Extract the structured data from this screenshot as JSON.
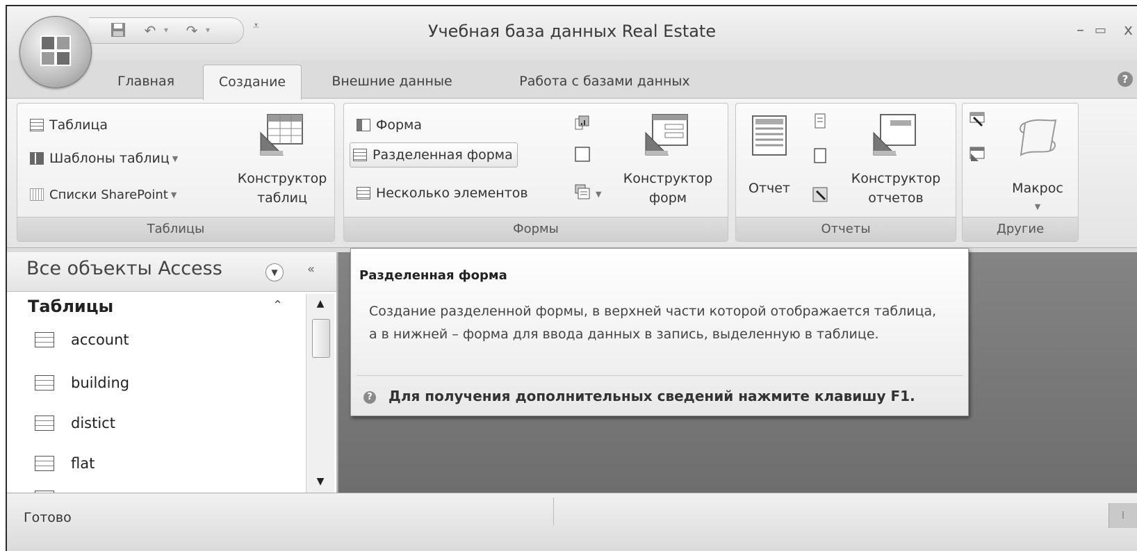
{
  "title": "Учебная база данных Real Estate",
  "tabs": [
    "Главная",
    "Создание",
    "Внешние данные",
    "Работа с базами данных"
  ],
  "ribbon": {
    "tables": {
      "label": "Таблицы",
      "table": "Таблица",
      "templates": "Шаблоны таблиц",
      "sharepoint": "Списки SharePoint",
      "designer_l1": "Конструктор",
      "designer_l2": "таблиц"
    },
    "forms": {
      "label": "Формы",
      "form": "Форма",
      "split": "Разделенная форма",
      "multiple": "Несколько элементов",
      "designer_l1": "Конструктор",
      "designer_l2": "форм"
    },
    "reports": {
      "label": "Отчеты",
      "report": "Отчет",
      "designer_l1": "Конструктор",
      "designer_l2": "отчетов"
    },
    "other": {
      "label": "Другие",
      "macro": "Макрос"
    }
  },
  "nav": {
    "title": "Все объекты Access",
    "section": "Таблицы",
    "items": [
      "account",
      "building",
      "distict",
      "flat"
    ]
  },
  "tooltip": {
    "title": "Разделенная форма",
    "body": "Создание разделенной формы, в верхней части которой отображается таблица, а в нижней – форма для ввода данных в запись, выделенную в таблице.",
    "help": "Для получения дополнительных сведений нажмите клавишу F1."
  },
  "status": "Готово"
}
